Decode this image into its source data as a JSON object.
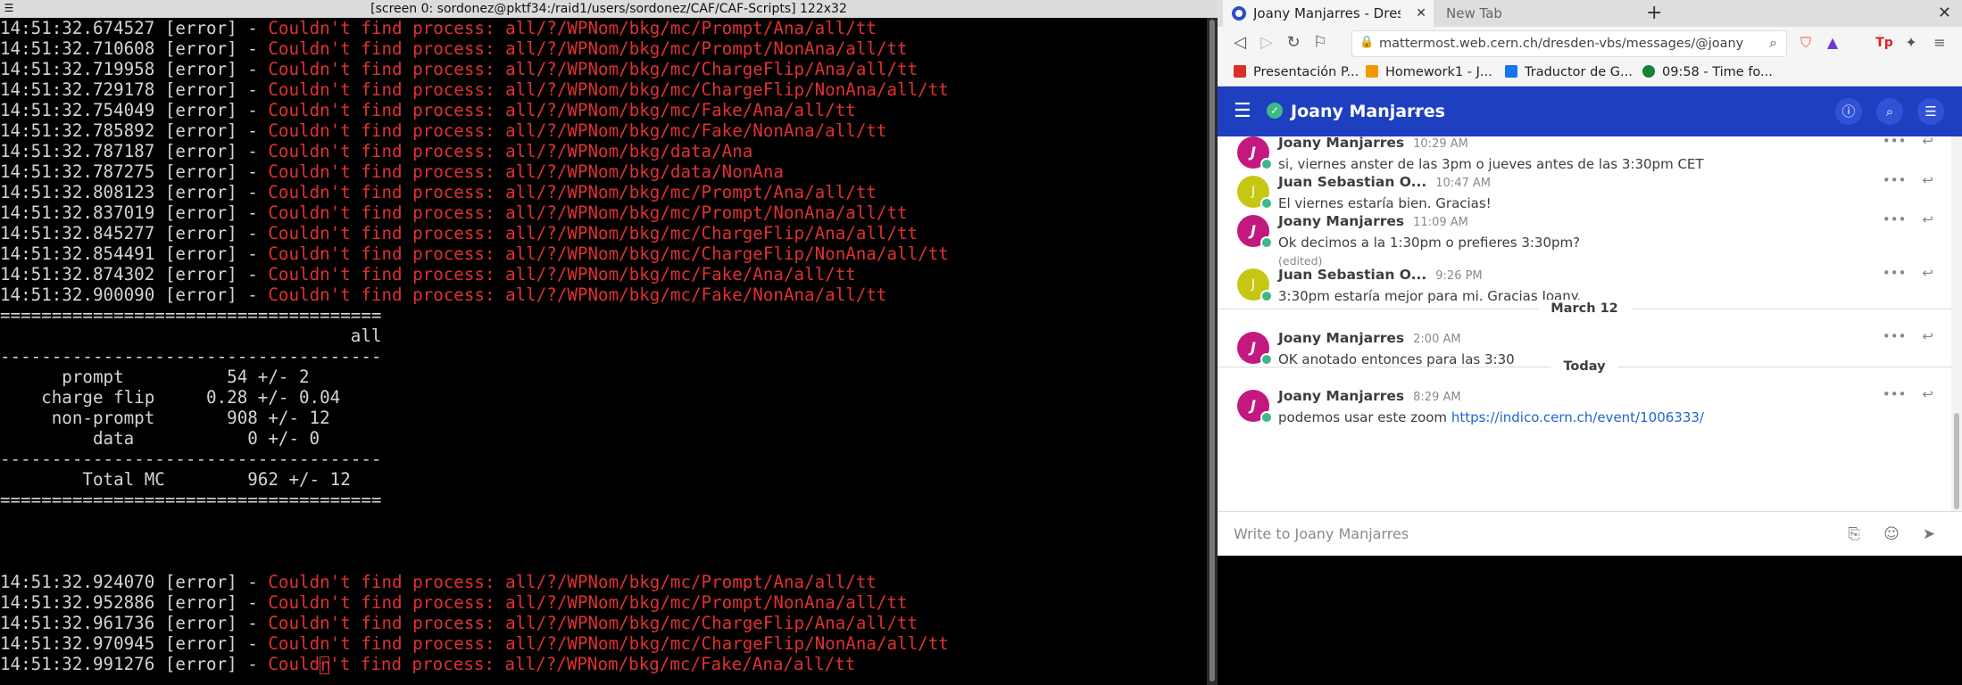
{
  "terminal": {
    "title": "[screen 0: sordonez@pktf34:/raid1/users/sordonez/CAF/CAF-Scripts] 122x32",
    "top_logs": [
      {
        "ts": "14:51:32.674527",
        "level": "[error]",
        "msg": "Couldn't find process: all/?/WPNom/bkg/mc/Prompt/Ana/all/tt"
      },
      {
        "ts": "14:51:32.710608",
        "level": "[error]",
        "msg": "Couldn't find process: all/?/WPNom/bkg/mc/Prompt/NonAna/all/tt"
      },
      {
        "ts": "14:51:32.719958",
        "level": "[error]",
        "msg": "Couldn't find process: all/?/WPNom/bkg/mc/ChargeFlip/Ana/all/tt"
      },
      {
        "ts": "14:51:32.729178",
        "level": "[error]",
        "msg": "Couldn't find process: all/?/WPNom/bkg/mc/ChargeFlip/NonAna/all/tt"
      },
      {
        "ts": "14:51:32.754049",
        "level": "[error]",
        "msg": "Couldn't find process: all/?/WPNom/bkg/mc/Fake/Ana/all/tt"
      },
      {
        "ts": "14:51:32.785892",
        "level": "[error]",
        "msg": "Couldn't find process: all/?/WPNom/bkg/mc/Fake/NonAna/all/tt"
      },
      {
        "ts": "14:51:32.787187",
        "level": "[error]",
        "msg": "Couldn't find process: all/?/WPNom/bkg/data/Ana"
      },
      {
        "ts": "14:51:32.787275",
        "level": "[error]",
        "msg": "Couldn't find process: all/?/WPNom/bkg/data/NonAna"
      },
      {
        "ts": "14:51:32.808123",
        "level": "[error]",
        "msg": "Couldn't find process: all/?/WPNom/bkg/mc/Prompt/Ana/all/tt"
      },
      {
        "ts": "14:51:32.837019",
        "level": "[error]",
        "msg": "Couldn't find process: all/?/WPNom/bkg/mc/Prompt/NonAna/all/tt"
      },
      {
        "ts": "14:51:32.845277",
        "level": "[error]",
        "msg": "Couldn't find process: all/?/WPNom/bkg/mc/ChargeFlip/Ana/all/tt"
      },
      {
        "ts": "14:51:32.854491",
        "level": "[error]",
        "msg": "Couldn't find process: all/?/WPNom/bkg/mc/ChargeFlip/NonAna/all/tt"
      },
      {
        "ts": "14:51:32.874302",
        "level": "[error]",
        "msg": "Couldn't find process: all/?/WPNom/bkg/mc/Fake/Ana/all/tt"
      },
      {
        "ts": "14:51:32.900090",
        "level": "[error]",
        "msg": "Couldn't find process: all/?/WPNom/bkg/mc/Fake/NonAna/all/tt"
      }
    ],
    "table_lines": [
      "=====================================",
      "                                  all",
      "-------------------------------------",
      "      prompt          54 +/- 2",
      "    charge flip     0.28 +/- 0.04",
      "     non-prompt       908 +/- 12",
      "         data           0 +/- 0",
      "-------------------------------------",
      "        Total MC        962 +/- 12",
      "====================================="
    ],
    "bottom_logs": [
      {
        "ts": "14:51:32.924070",
        "level": "[error]",
        "msg": "Couldn't find process: all/?/WPNom/bkg/mc/Prompt/Ana/all/tt"
      },
      {
        "ts": "14:51:32.952886",
        "level": "[error]",
        "msg": "Couldn't find process: all/?/WPNom/bkg/mc/Prompt/NonAna/all/tt"
      },
      {
        "ts": "14:51:32.961736",
        "level": "[error]",
        "msg": "Couldn't find process: all/?/WPNom/bkg/mc/ChargeFlip/Ana/all/tt"
      },
      {
        "ts": "14:51:32.970945",
        "level": "[error]",
        "msg": "Couldn't find process: all/?/WPNom/bkg/mc/ChargeFlip/NonAna/all/tt"
      }
    ],
    "last_log": {
      "ts": "14:51:32.991276",
      "level": "[error]",
      "msg_pre": "Could",
      "msg_post": "'t find process: all/?/WPNom/bkg/mc/Fake/Ana/all/tt",
      "cursor_char": "n"
    }
  },
  "browser": {
    "tab_active_label": "Joany Manjarres - Dresden",
    "tab_close": "✕",
    "tab_new_label": "New Tab",
    "new_tab_plus": "+",
    "window_close": "✕",
    "url": "mattermost.web.cern.ch/dresden-vbs/messages/@joany",
    "bookmarks": [
      {
        "label": "Presentación P...",
        "color": "#d93025"
      },
      {
        "label": "Homework1 - J...",
        "color": "#f29900"
      },
      {
        "label": "Traductor de G...",
        "color": "#1a73e8"
      },
      {
        "label": "09:58 - Time fo...",
        "color": "#188038"
      }
    ]
  },
  "mattermost": {
    "channel_name": "Joany Manjarres",
    "posts": [
      {
        "avatar": "J",
        "author": "Joany Manjarres",
        "time": "10:29 AM",
        "text": "si, viernes anster de las 3pm o jueves antes de las 3:30pm CET"
      },
      {
        "avatar": "J",
        "author": "Juan Sebastian O...",
        "time": "10:47 AM",
        "text": "El viernes estaría bien. Gracias!"
      },
      {
        "avatar": "J",
        "author": "Joany Manjarres",
        "time": "11:09 AM",
        "text": "Ok decimos a la 1:30pm o prefieres 3:30pm?",
        "edited": "(edited)"
      },
      {
        "avatar": "J",
        "author": "Juan Sebastian O...",
        "time": "9:26 PM",
        "text": "3:30pm estaría mejor para mi. Gracias Joany."
      },
      {
        "avatar": "J",
        "author": "Joany Manjarres",
        "time": "2:00 AM",
        "text": "OK anotado entonces para las 3:30"
      },
      {
        "avatar": "J",
        "author": "Joany Manjarres",
        "time": "8:29 AM",
        "text": "podemos usar este zoom ",
        "link": "https://indico.cern.ch/event/1006333/"
      }
    ],
    "separators": [
      "March 12",
      "Today"
    ],
    "composer_placeholder": "Write to Joany Manjarres"
  },
  "colors": {
    "error_red": "#e03131",
    "mattermost_blue": "#1e3fbf",
    "online_green": "#3db887",
    "link_blue": "#2066d0"
  }
}
